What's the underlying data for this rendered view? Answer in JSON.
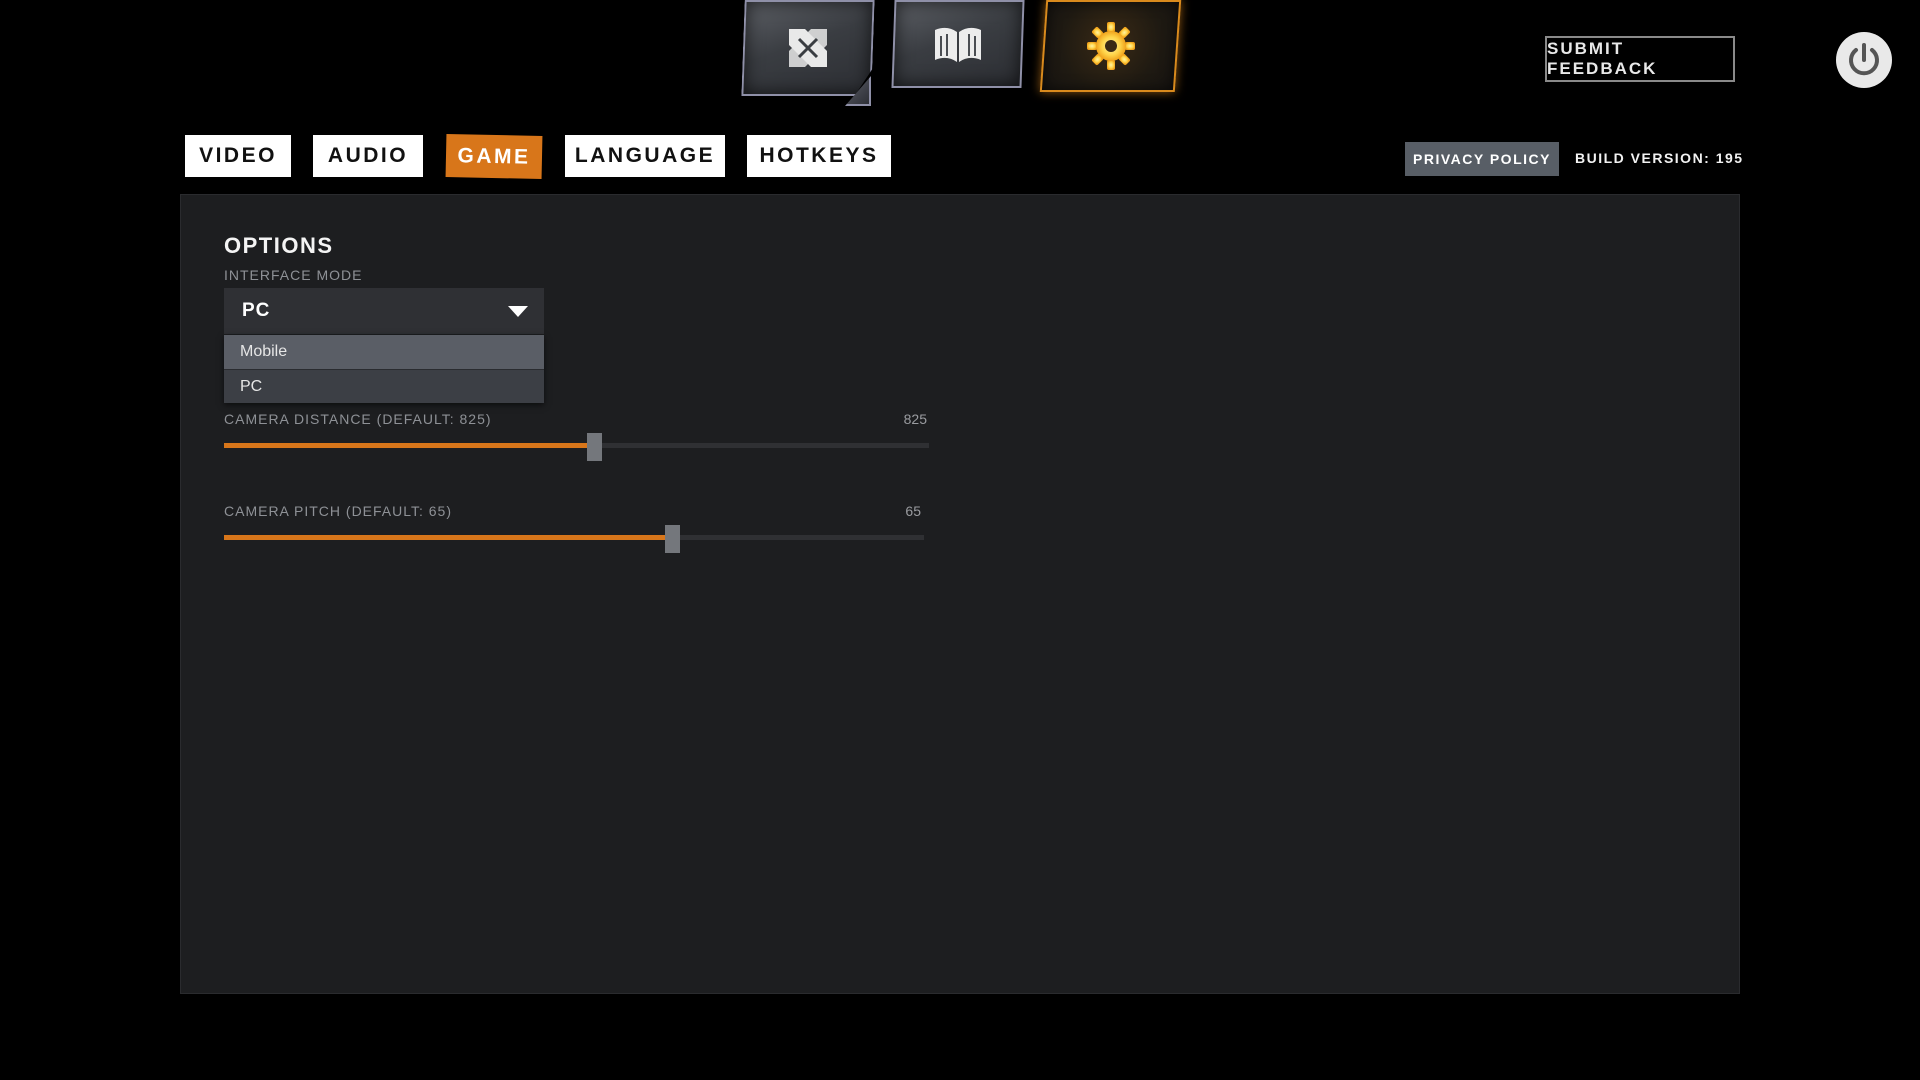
{
  "topnav": {
    "items": [
      {
        "icon": "crossed-swords-icon",
        "active": false
      },
      {
        "icon": "open-book-icon",
        "active": false
      },
      {
        "icon": "gear-icon",
        "active": true
      }
    ]
  },
  "header": {
    "feedback_label": "SUBMIT FEEDBACK",
    "power_icon": "power-icon"
  },
  "tabs": [
    {
      "label": "VIDEO",
      "active": false
    },
    {
      "label": "AUDIO",
      "active": false
    },
    {
      "label": "GAME",
      "active": true
    },
    {
      "label": "LANGUAGE",
      "active": false
    },
    {
      "label": "HOTKEYS",
      "active": false
    }
  ],
  "meta": {
    "privacy_label": "PRIVACY POLICY",
    "build_version": "BUILD VERSION: 195"
  },
  "options": {
    "title": "OPTIONS",
    "interface_mode": {
      "label": "INTERFACE MODE",
      "value": "PC",
      "options": [
        "Mobile",
        "PC"
      ],
      "hovered": "Mobile"
    },
    "camera_distance": {
      "label": "CAMERA DISTANCE  (DEFAULT: 825)",
      "value_text": "825",
      "fraction": 0.525
    },
    "camera_pitch": {
      "label": "CAMERA PITCH  (DEFAULT: 65)",
      "value_text": "65",
      "fraction": 0.64
    }
  },
  "colors": {
    "accent": "#d8761a",
    "panel": "#1d1e20"
  }
}
